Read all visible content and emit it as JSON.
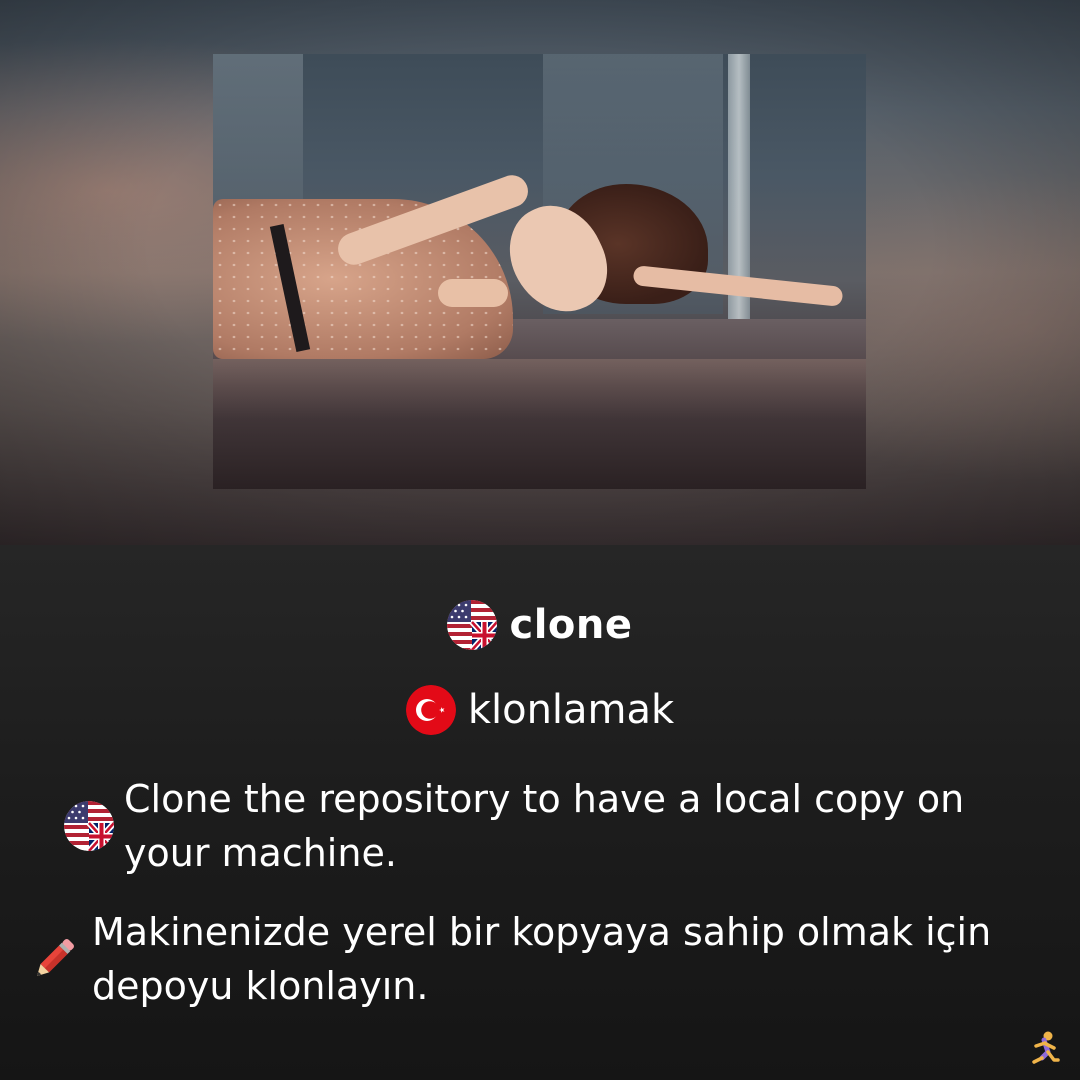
{
  "photo": {
    "alt_icon": "photo-woman-lying-on-floor"
  },
  "term": {
    "en_flag_icon": "us-uk-flag-icon",
    "en_word": "clone",
    "tr_flag_icon": "turkey-flag-icon",
    "tr_word": "klonlamak"
  },
  "example": {
    "en_flag_icon": "us-uk-flag-icon",
    "en_sentence": "Clone the repository to have a local copy on your machine.",
    "tr_icon": "pencil-icon",
    "tr_sentence": "Makinenizde yerel bir kopyaya sahip olmak için depoyu klonlayın."
  },
  "footer": {
    "icon": "runner-icon"
  },
  "colors": {
    "background": "#1b1b1b",
    "text": "#ffffff",
    "turkey_red": "#e30a17"
  }
}
